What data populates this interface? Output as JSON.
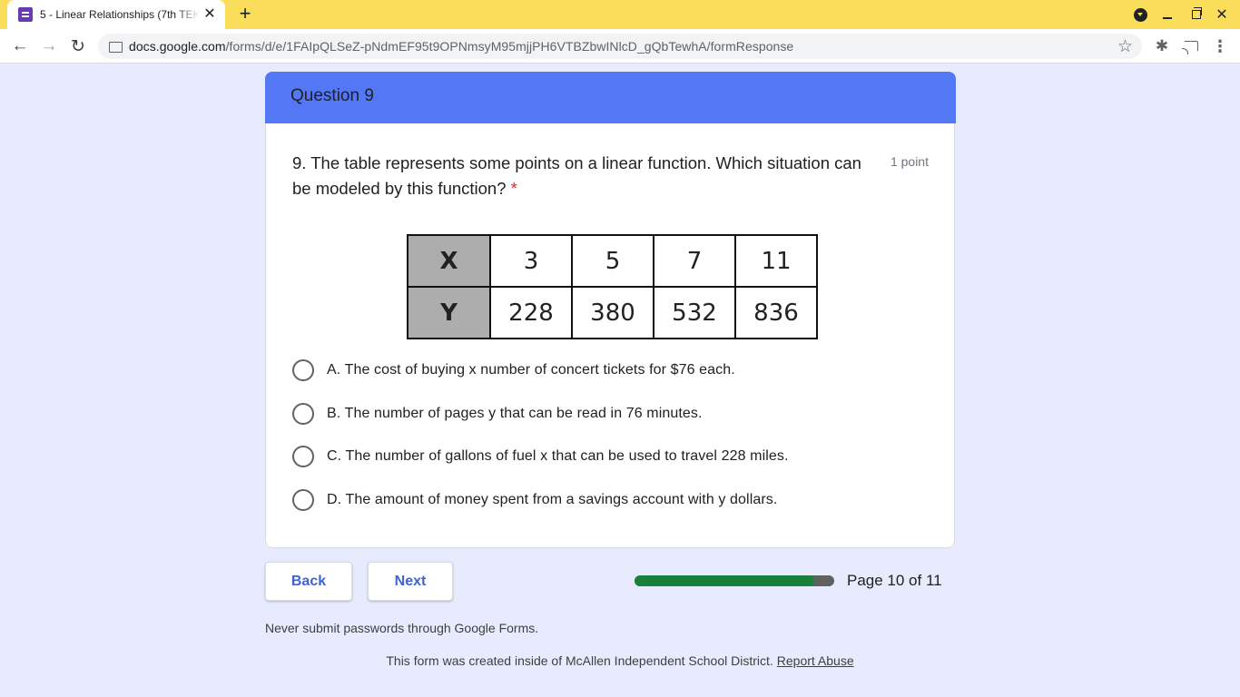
{
  "browser": {
    "tab_title": "5 - Linear Relationships (7th TEK",
    "tab_close": "✕",
    "new_tab": "+",
    "url_host": "docs.google.com",
    "url_path": "/forms/d/e/1FAIpQLSeZ-pNdmEF95t9OPNmsyM95mjjPH6VTBZbwINlcD_gQbTewhA/formResponse",
    "nav_back": "←",
    "nav_forward": "→",
    "nav_reload": "↻",
    "star": "☆",
    "extensions": "✱",
    "menu": "⋮",
    "win_close": "✕"
  },
  "section": {
    "title": "Question 9"
  },
  "question": {
    "text": "9. The table represents some points on a linear function. Which situation can be modeled by this function?",
    "required_mark": "*",
    "points": "1 point"
  },
  "table": {
    "x_label": "X",
    "y_label": "Y",
    "x_values": [
      "3",
      "5",
      "7",
      "11"
    ],
    "y_values": [
      "228",
      "380",
      "532",
      "836"
    ]
  },
  "options": [
    {
      "label": "A. The cost of buying x number of concert tickets for $76 each."
    },
    {
      "label": "B. The number of pages y that can be read in 76 minutes."
    },
    {
      "label": "C. The number of gallons of fuel x that can be used to travel 228 miles."
    },
    {
      "label": "D. The amount of money spent from a savings account with y dollars."
    }
  ],
  "navigation": {
    "back_label": "Back",
    "next_label": "Next",
    "progress_fraction": 0.9,
    "page_indicator": "Page 10 of 11"
  },
  "footer": {
    "warning": "Never submit passwords through Google Forms.",
    "created_text": "This form was created inside of McAllen Independent School District.",
    "report_link": "Report Abuse"
  }
}
